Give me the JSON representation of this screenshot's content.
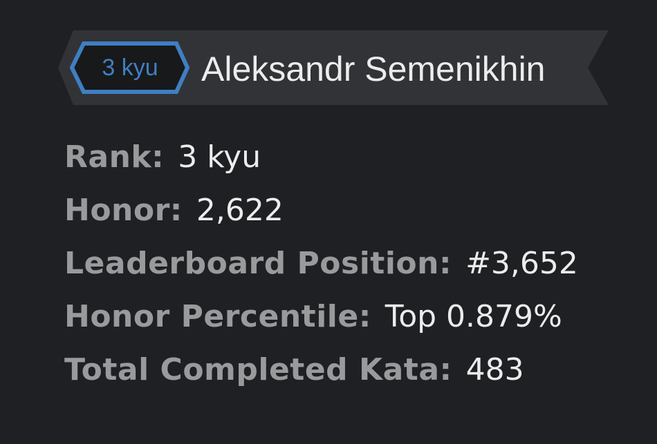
{
  "profile": {
    "rank_badge": "3 kyu",
    "rank_color": "#3f7fc2",
    "username": "Aleksandr Semenikhin"
  },
  "stats": [
    {
      "label": "Rank:",
      "value": "3 kyu"
    },
    {
      "label": "Honor:",
      "value": "2,622"
    },
    {
      "label": "Leaderboard Position:",
      "value": "#3,652"
    },
    {
      "label": "Honor Percentile:",
      "value": "Top 0.879%"
    },
    {
      "label": "Total Completed Kata:",
      "value": "483"
    }
  ]
}
